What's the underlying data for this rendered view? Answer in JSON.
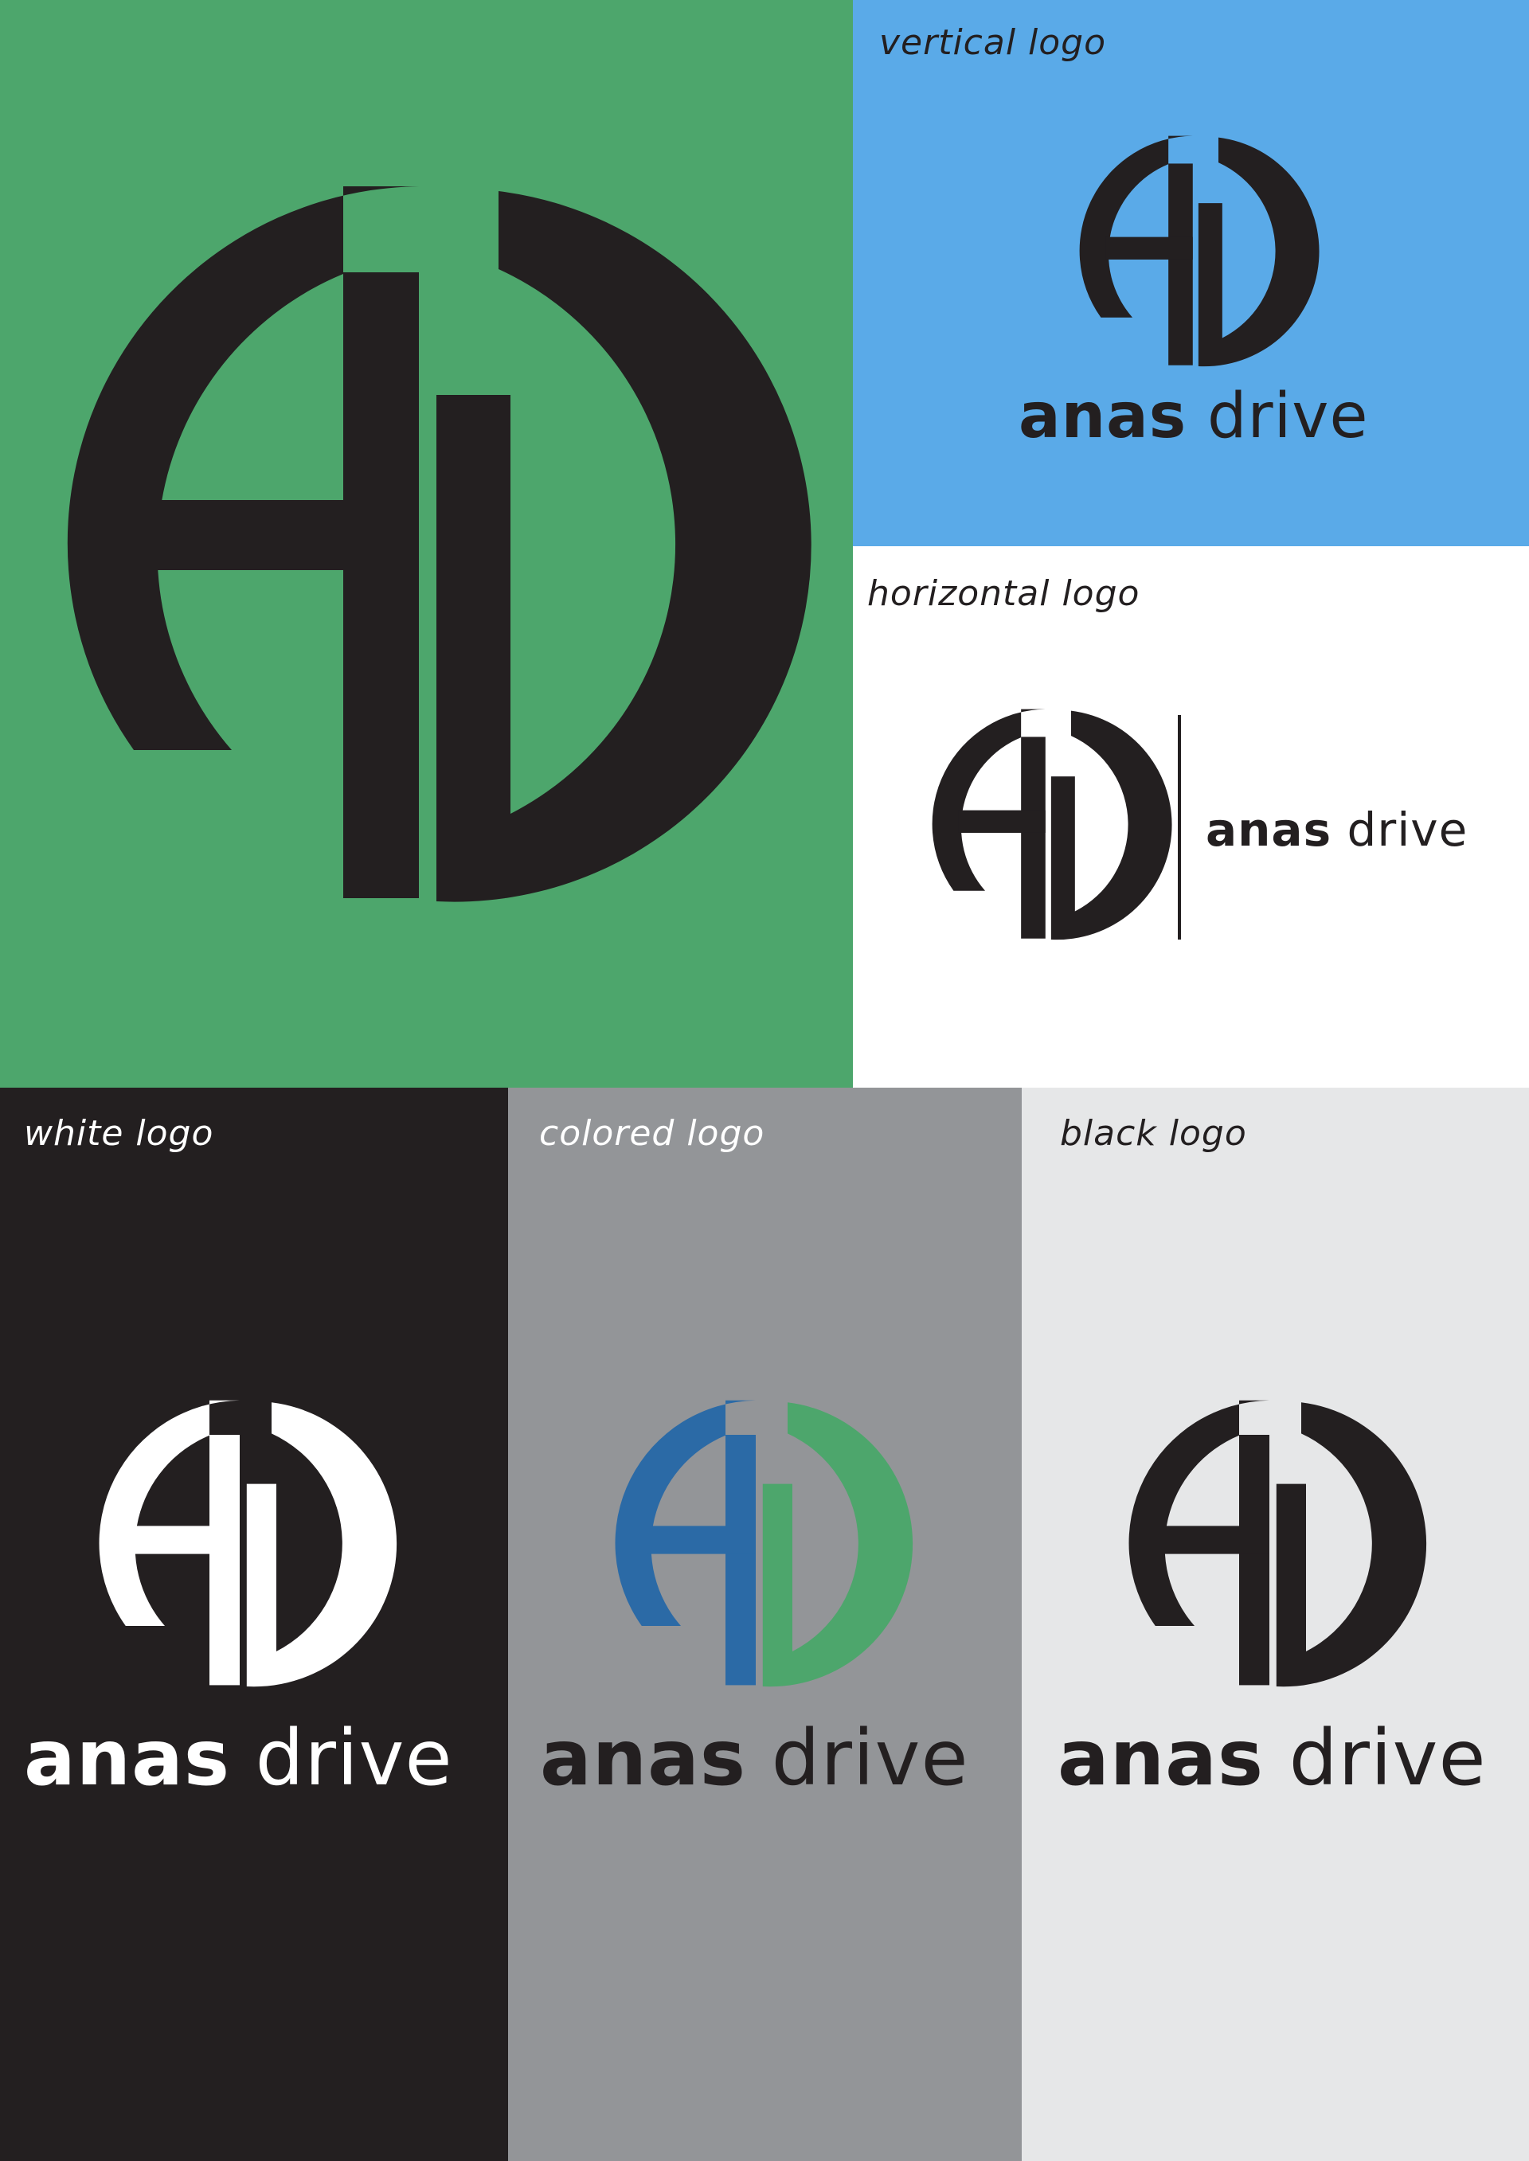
{
  "captions": {
    "vertical": "vertical logo",
    "horizontal": "horizontal logo",
    "white": "white logo",
    "colored": "colored logo",
    "black": "black logo"
  },
  "brand": {
    "name_bold": "anas",
    "name_light": "drive",
    "monogram": "AD"
  },
  "colors": {
    "green_panel": "#4da66c",
    "blue_panel": "#5aaae8",
    "black_panel": "#231f20",
    "gray_panel": "#939598",
    "light_panel": "#e6e7e8",
    "logo_dark": "#231f20",
    "logo_white": "#ffffff",
    "logo_blue": "#2b6aa6",
    "logo_green": "#4da66c"
  }
}
